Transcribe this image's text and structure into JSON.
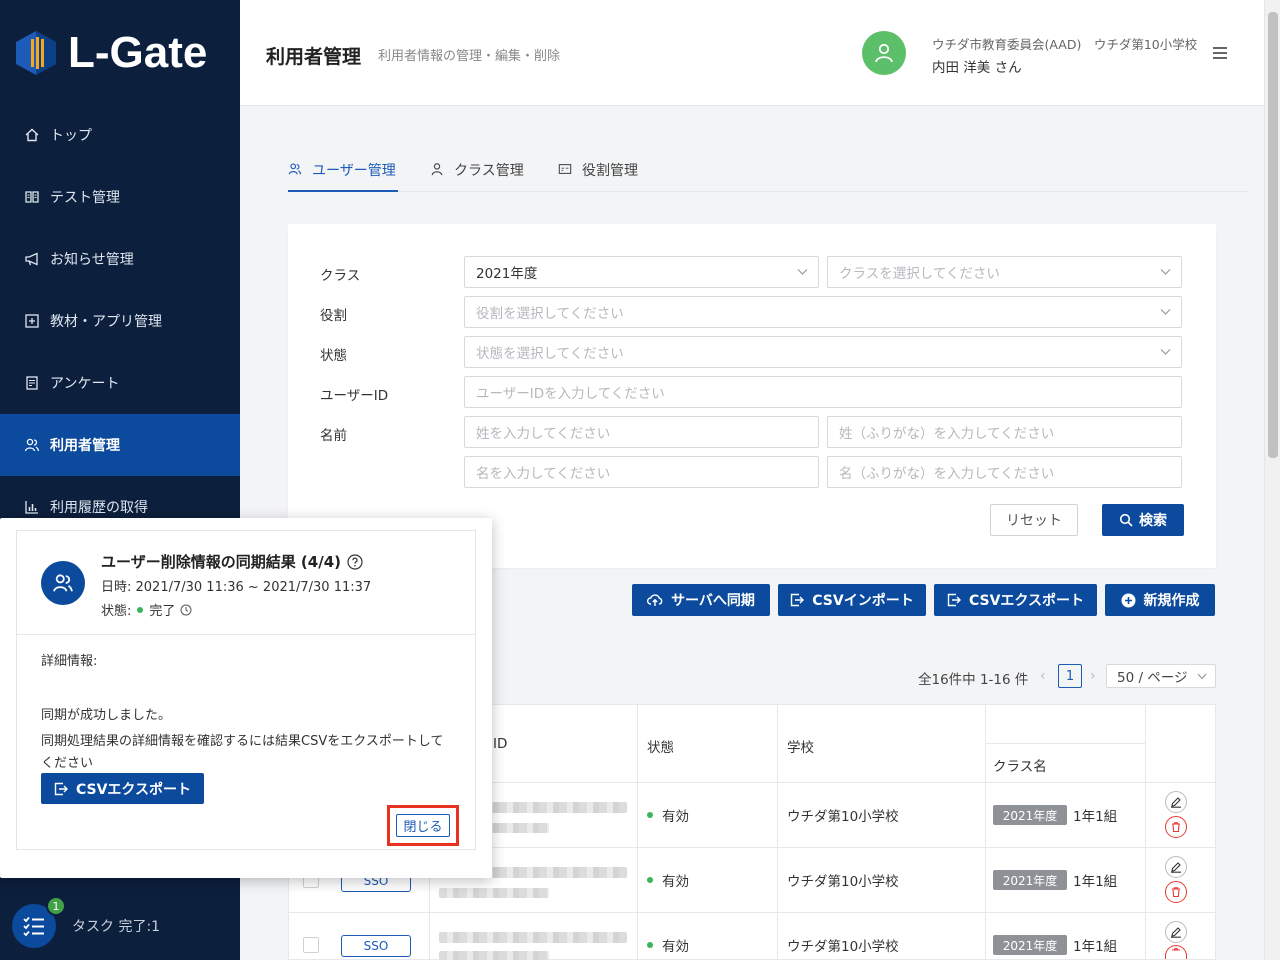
{
  "app": {
    "logo_text": "L-Gate"
  },
  "sidebar": {
    "items": [
      {
        "label": "トップ",
        "icon": "home-icon"
      },
      {
        "label": "テスト管理",
        "icon": "book-icon"
      },
      {
        "label": "お知らせ管理",
        "icon": "megaphone-icon"
      },
      {
        "label": "教材・アプリ管理",
        "icon": "plus-square-icon"
      },
      {
        "label": "アンケート",
        "icon": "survey-icon"
      },
      {
        "label": "利用者管理",
        "icon": "users-icon",
        "active": true
      },
      {
        "label": "利用履歴の取得",
        "icon": "bar-chart-icon"
      }
    ],
    "task_badge": "1",
    "task_label": "タスク 完了:1"
  },
  "header": {
    "title": "利用者管理",
    "subtitle": "利用者情報の管理・編集・削除",
    "user_org": "ウチダ市教育委員会(AAD)　ウチダ第10小学校",
    "user_name": "内田 洋美 さん"
  },
  "tabs": [
    {
      "label": "ユーザー管理",
      "icon": "users-icon",
      "active": true
    },
    {
      "label": "クラス管理",
      "icon": "user-icon"
    },
    {
      "label": "役割管理",
      "icon": "id-card-icon"
    }
  ],
  "search": {
    "class_label": "クラス",
    "class_year_value": "2021年度",
    "class_placeholder": "クラスを選択してください",
    "role_label": "役割",
    "role_placeholder": "役割を選択してください",
    "status_label": "状態",
    "status_placeholder": "状態を選択してください",
    "userid_label": "ユーザーID",
    "userid_placeholder": "ユーザーIDを入力してください",
    "name_label": "名前",
    "last_name_placeholder": "姓を入力してください",
    "last_kana_placeholder": "姓（ふりがな）を入力してください",
    "first_name_placeholder": "名を入力してください",
    "first_kana_placeholder": "名（ふりがな）を入力してください",
    "reset_label": "リセット",
    "search_label": "検索"
  },
  "actions": {
    "sync_label": "サーバへ同期",
    "import_label": "CSVインポート",
    "export_label": "CSVエクスポート",
    "new_label": "新規作成"
  },
  "pagination": {
    "total": "全16件中 1-16 件",
    "current_page": "1",
    "page_size": "50 / ページ"
  },
  "table": {
    "headers": {
      "id": "ID",
      "status": "状態",
      "school": "学校",
      "class_name": "クラス名"
    },
    "rows": [
      {
        "sso": "",
        "status": "有効",
        "school": "ウチダ第10小学校",
        "year": "2021年度",
        "class": "1年1組"
      },
      {
        "sso": "SSO",
        "status": "有効",
        "school": "ウチダ第10小学校",
        "year": "2021年度",
        "class": "1年1組"
      },
      {
        "sso": "SSO",
        "status": "有効",
        "school": "ウチダ第10小学校",
        "year": "2021年度",
        "class": "1年1組"
      }
    ]
  },
  "popup": {
    "title": "ユーザー削除情報の同期結果 (4/4)",
    "date": "日時: 2021/7/30 11:36 ~ 2021/7/30 11:37",
    "status_label": "状態:",
    "status_value": "完了",
    "detail_label": "詳細情報:",
    "success_message": "同期が成功しました。",
    "description": "同期処理結果の詳細情報を確認するには結果CSVをエクスポートしてください",
    "csv_button": "CSVエクスポート",
    "close_button": "閉じる"
  },
  "colors": {
    "sidebar_bg": "#0c1f3c",
    "primary": "#0b4a9c",
    "accent_blue": "#1d5bb8",
    "success_green": "#3db35a",
    "highlight_red": "#e8321f"
  }
}
